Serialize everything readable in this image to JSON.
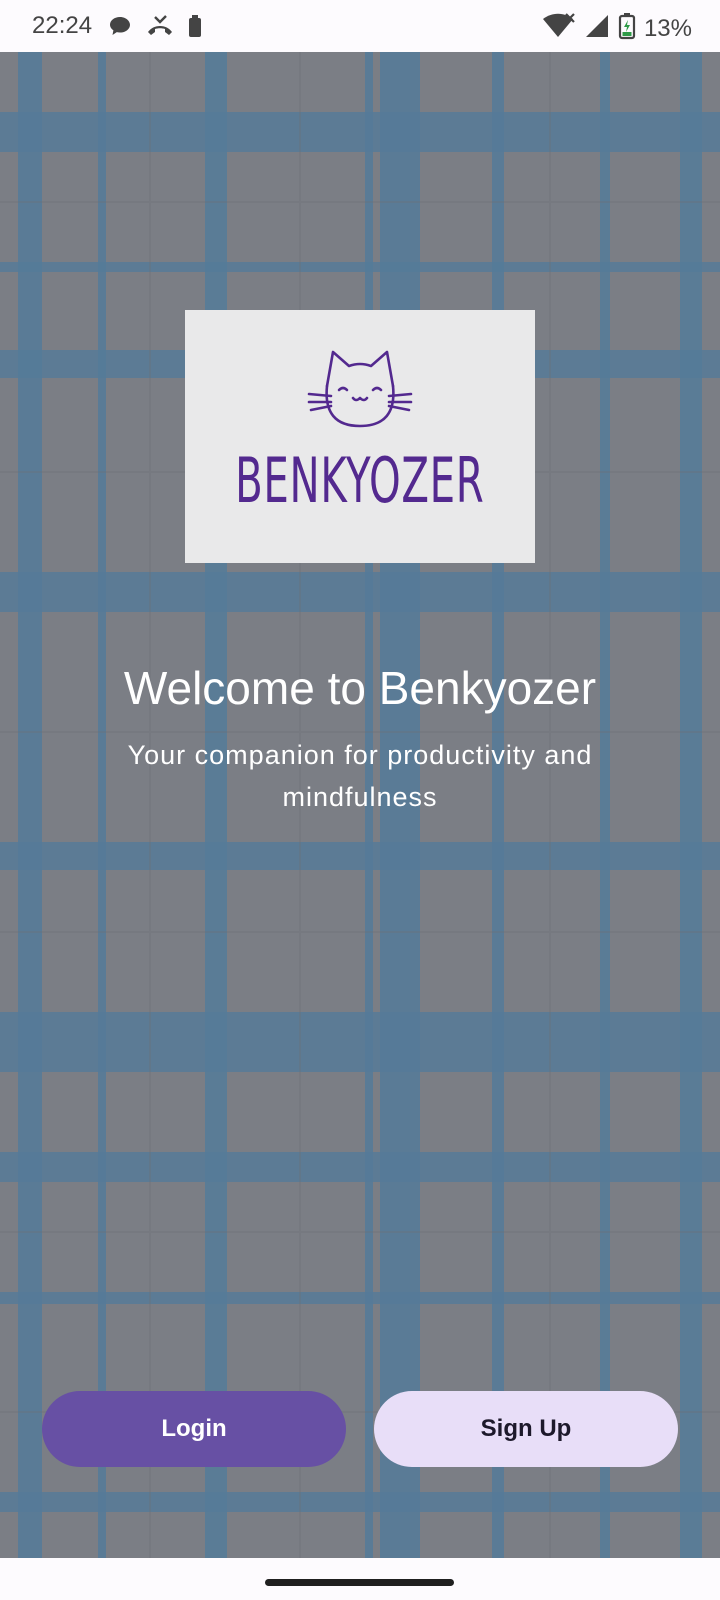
{
  "status_bar": {
    "time": "22:24",
    "battery_percent": "13%",
    "left_icons": [
      "chat-bubble-icon",
      "missed-call-icon",
      "battery-saver-icon"
    ],
    "right_icons": [
      "wifi-icon",
      "signal-icon",
      "battery-charging-icon"
    ]
  },
  "logo": {
    "wordmark": "BENKYOZER",
    "icon": "cat-face-icon",
    "color": "#53298f"
  },
  "welcome": {
    "title": "Welcome to Benkyozer",
    "subtitle": "Your companion for productivity and mindfulness"
  },
  "actions": {
    "login_label": "Login",
    "signup_label": "Sign Up"
  },
  "colors": {
    "primary": "#6750a4",
    "secondary_container": "#e8def8",
    "background": "#7b7e85",
    "grid_lines": "#5a7f9c"
  }
}
